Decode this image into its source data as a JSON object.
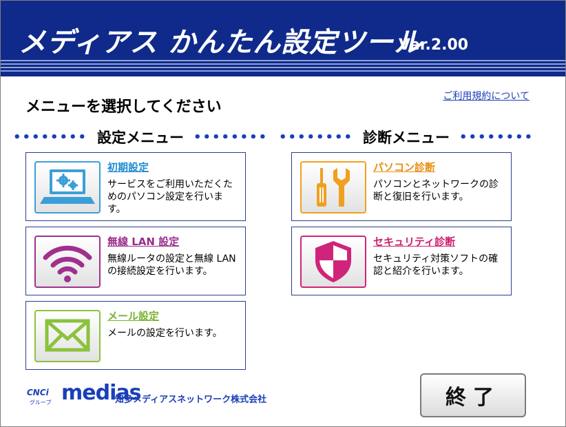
{
  "header": {
    "title": "メディアス かんたん設定ツール",
    "version": "Ver.2.00"
  },
  "subtitle": "メニューを選択してください",
  "terms_link": "ご利用規約について",
  "sections": {
    "settings_heading": "設定メニュー",
    "diagnosis_heading": "診断メニュー",
    "dots": "••••••••"
  },
  "settings_menu": [
    {
      "title": "初期設定",
      "description": "サービスをご利用いただくためのパソコン設定を行います。",
      "icon": "laptop-gears-icon",
      "color": "#1f8bd0"
    },
    {
      "title": "無線 LAN 設定",
      "description": "無線ルータの設定と無線 LAN の接続設定を行います。",
      "icon": "wifi-icon",
      "color": "#9b2b8b"
    },
    {
      "title": "メール設定",
      "description": "メールの設定を行います。",
      "icon": "envelope-icon",
      "color": "#7ab32e"
    }
  ],
  "diagnosis_menu": [
    {
      "title": "パソコン診断",
      "description": "パソコンとネットワークの診断と復旧を行います。",
      "icon": "tools-icon",
      "color": "#e98e10"
    },
    {
      "title": "セキュリティ診断",
      "description": "セキュリティ対策ソフトの確認と紹介を行います。",
      "icon": "shield-icon",
      "color": "#cc1f6f"
    }
  ],
  "footer": {
    "logo_cnci": "CNCi",
    "logo_cnci_sub": "グループ",
    "logo_medias": "medias",
    "company": "知多メディアスネットワーク株式会社"
  },
  "exit_button": "終了",
  "colors": {
    "header_bg": "#0f2a8a",
    "accent_blue": "#1a3fb8"
  }
}
